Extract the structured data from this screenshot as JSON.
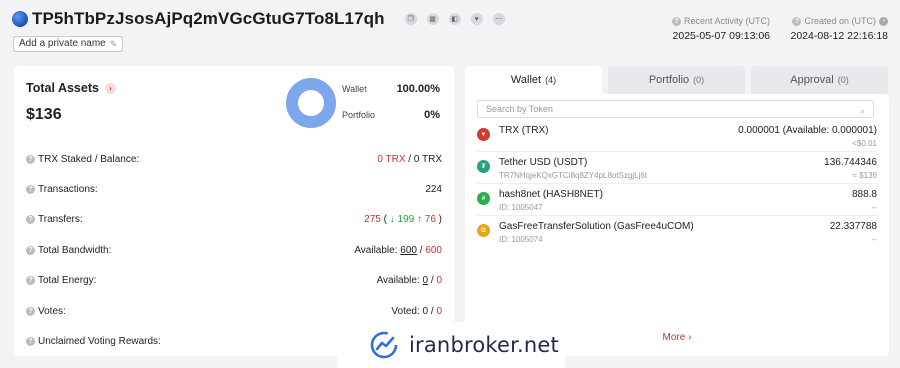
{
  "header": {
    "address": "TP5hTbPzJsosAjPq2mVGcGtuG7To8L17qh",
    "action_icons": [
      "copy-icon",
      "qr-code-icon",
      "tag-icon",
      "heart-icon",
      "more-icon"
    ],
    "private_name_label": "Add a private name",
    "recent_activity_label": "Recent Activity (UTC)",
    "recent_activity_value": "2025-05-07 09:13:06",
    "created_on_label": "Created on (UTC)",
    "created_on_value": "2024-08-12 22:16:18"
  },
  "assets": {
    "title": "Total Assets",
    "value": "$136",
    "legend": [
      {
        "label": "Wallet",
        "value": "100.00%"
      },
      {
        "label": "Portfolio",
        "value": "0%"
      }
    ],
    "donut_color": "#7ea6ea"
  },
  "stats": {
    "staked": {
      "label": "TRX Staked / Balance:",
      "a": "0 TRX",
      "b": " / 0 TRX"
    },
    "transactions": {
      "label": "Transactions:",
      "value": "224"
    },
    "transfers": {
      "label": "Transfers:",
      "total": "275",
      "open": " ( ",
      "down": "↓ 199",
      "up": "↑ 76",
      "close": " )"
    },
    "bandwidth": {
      "label": "Total Bandwidth:",
      "prefix": "Available: ",
      "used": "600",
      "sep": " / ",
      "total": "600"
    },
    "energy": {
      "label": "Total Energy:",
      "prefix": "Available: ",
      "used": "0",
      "sep": " / ",
      "total": "0"
    },
    "votes": {
      "label": "Votes:",
      "prefix": "Voted: ",
      "used": "0",
      "sep": " / ",
      "total": "0"
    },
    "rewards": {
      "label": "Unclaimed Voting Rewards:"
    }
  },
  "tabs": [
    {
      "label": "Wallet",
      "count": "(4)"
    },
    {
      "label": "Portfolio",
      "count": "(0)"
    },
    {
      "label": "Approval",
      "count": "(0)"
    }
  ],
  "search": {
    "placeholder": "Search by Token"
  },
  "tokens": [
    {
      "name": "TRX (TRX)",
      "sub": "",
      "amount": "0.000001 (Available: 0.000001)",
      "usd": "<$0.01",
      "icon": "trx-icon",
      "color": "#d23b2f"
    },
    {
      "name": "Tether USD (USDT)",
      "sub": "TR7NHqjeKQxGTCi8q8ZY4pL8otSzgjLj6t",
      "amount": "136.744346",
      "usd": "≈ $136",
      "icon": "tether-icon",
      "color": "#26a17b"
    },
    {
      "name": "hash8net (HASH8NET)",
      "sub": "ID: 1005047",
      "amount": "888.8",
      "usd": "--",
      "icon": "hash8net-icon",
      "color": "#2cae4e"
    },
    {
      "name": "GasFreeTransferSolution (GasFree4uCOM)",
      "sub": "ID: 1005074",
      "amount": "22.337788",
      "usd": "--",
      "icon": "gasfree-icon",
      "color": "#e8a51a"
    }
  ],
  "more_label": "More",
  "watermark": "iranbroker.net"
}
